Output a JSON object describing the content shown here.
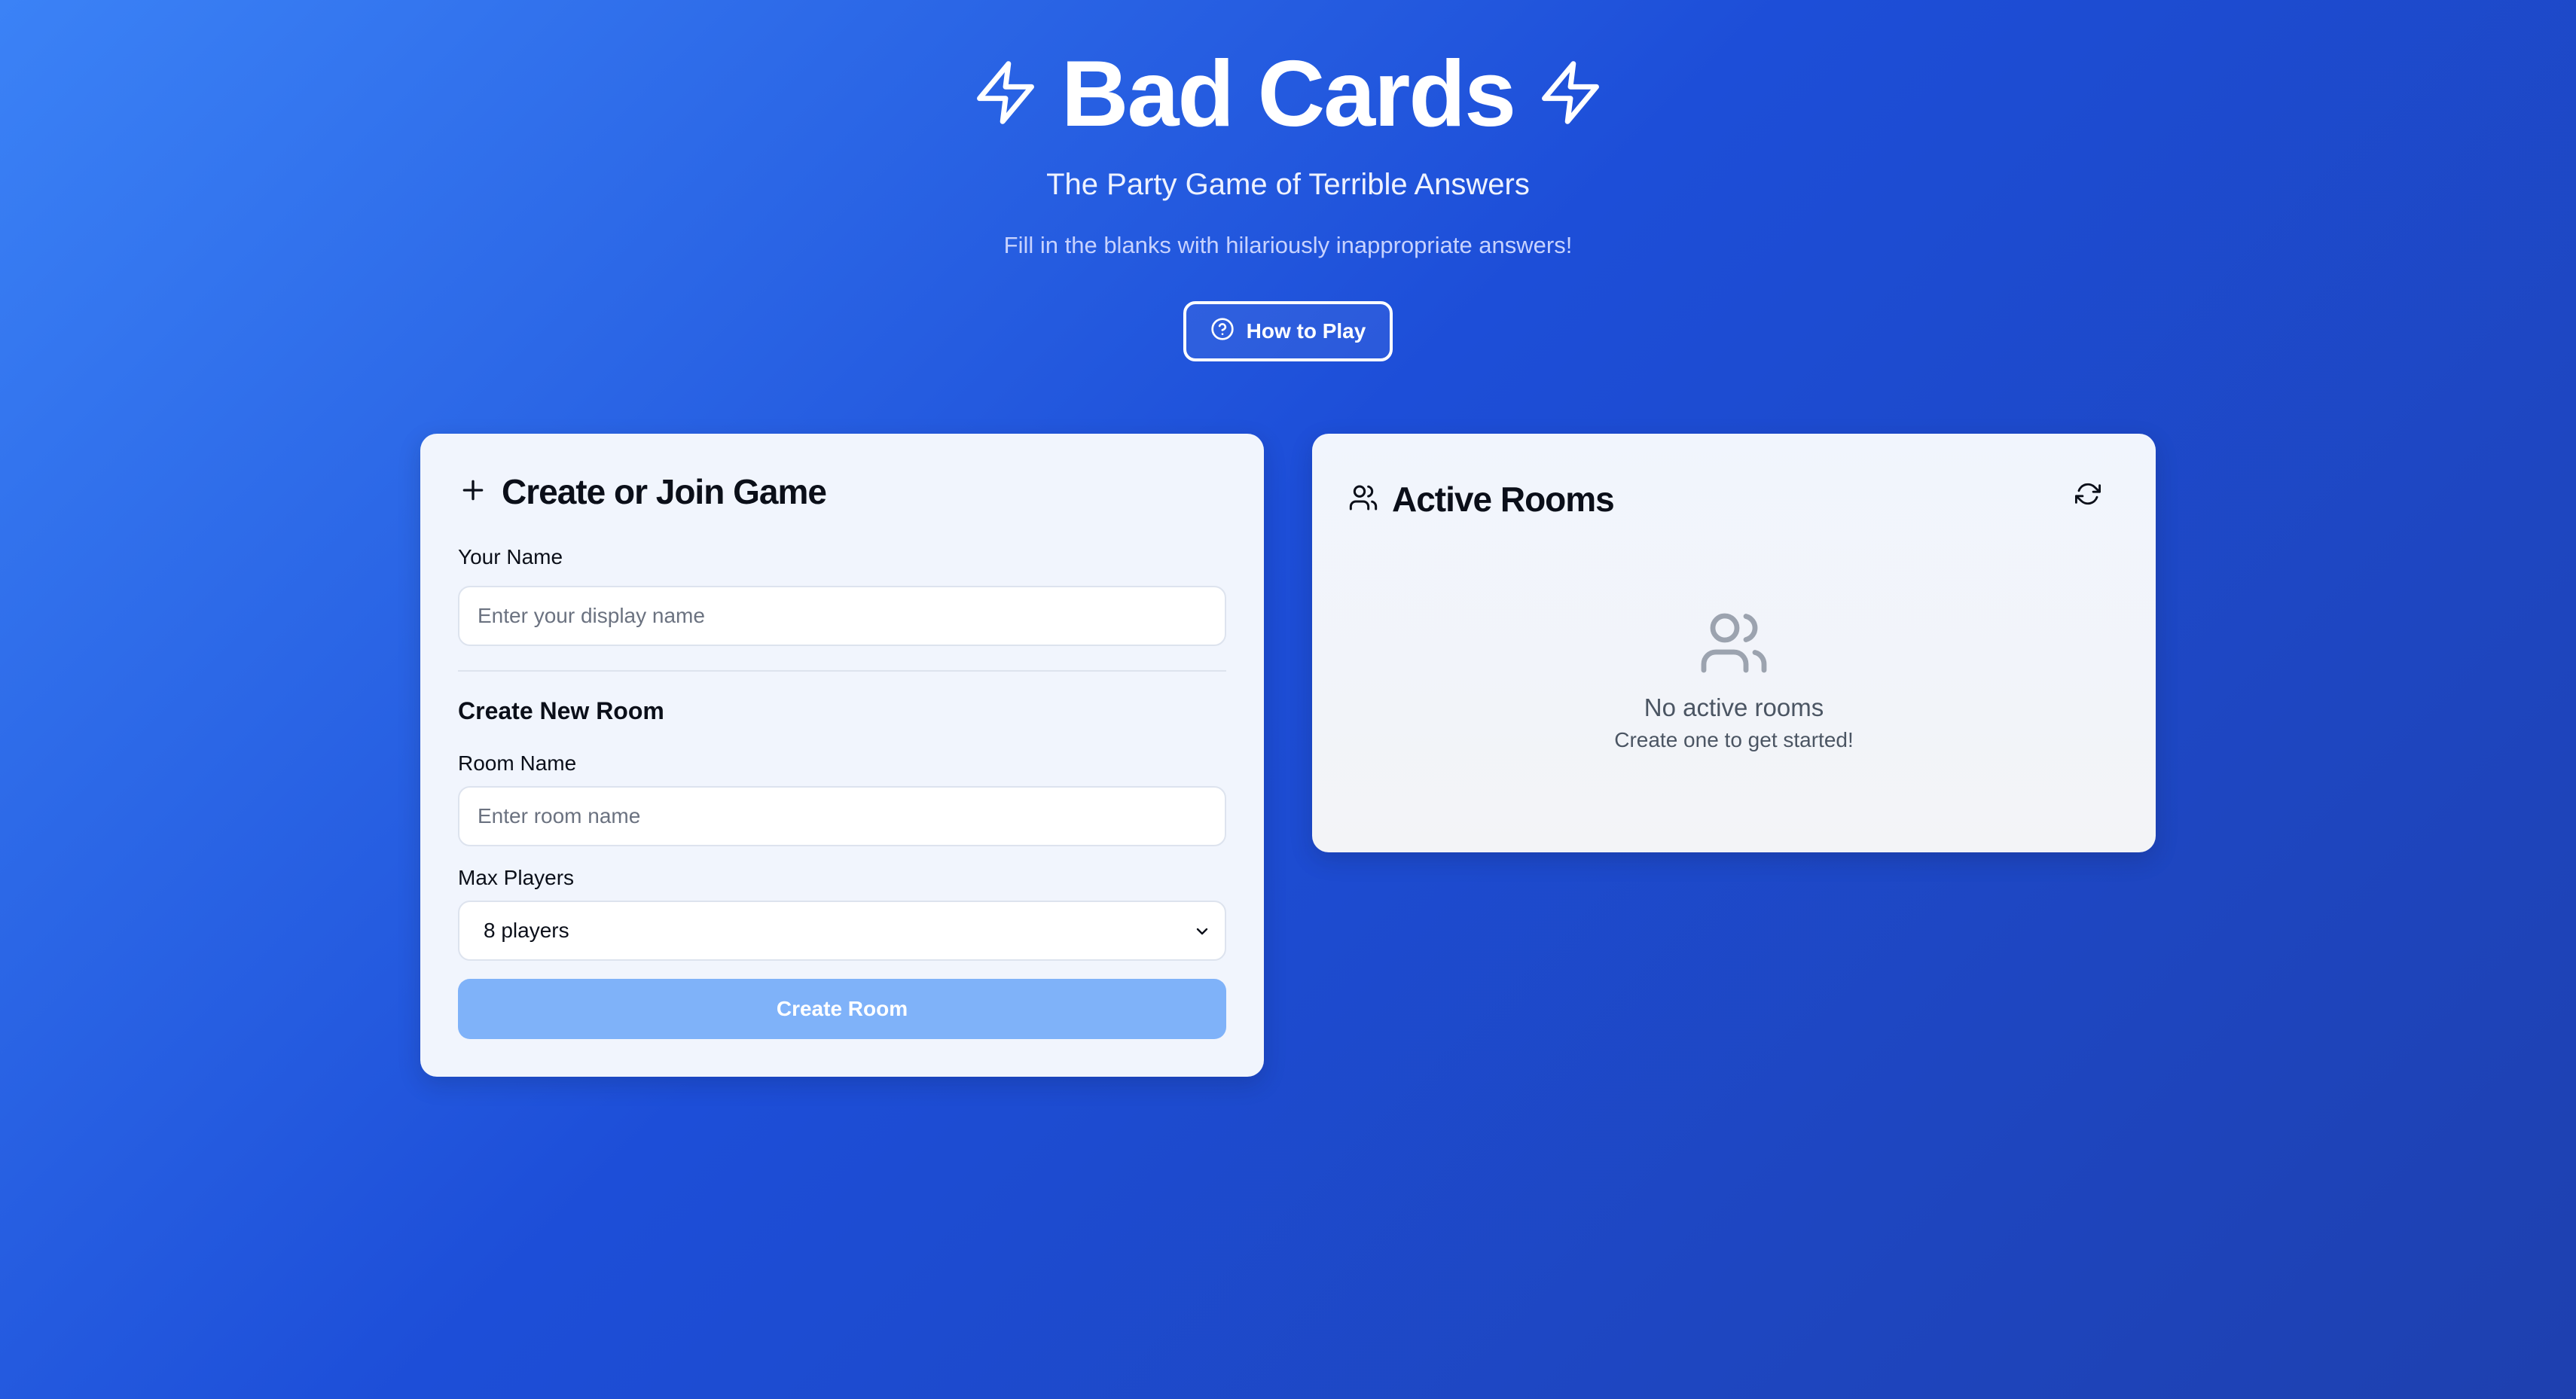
{
  "hero": {
    "title": "Bad Cards",
    "subtitle": "The Party Game of Terrible Answers",
    "tagline": "Fill in the blanks with hilariously inappropriate answers!",
    "how_to_play_label": "How to Play",
    "title_icon": "zap-icon",
    "help_icon": "question-circle-icon"
  },
  "create_card": {
    "icon": "plus-icon",
    "title": "Create or Join Game",
    "name_label": "Your Name",
    "name_placeholder": "Enter your display name",
    "name_value": "",
    "section_title": "Create New Room",
    "room_label": "Room Name",
    "room_placeholder": "Enter room name",
    "room_value": "",
    "max_players_label": "Max Players",
    "max_players_value": "8 players",
    "create_button_label": "Create Room"
  },
  "rooms_card": {
    "icon": "users-icon",
    "title": "Active Rooms",
    "refresh_icon": "refresh-icon",
    "empty_icon": "users-icon",
    "empty_title": "No active rooms",
    "empty_subtitle": "Create one to get started!"
  },
  "colors": {
    "background_start": "#3b82f6",
    "background_end": "#1e40af",
    "card_background": "#f1f5fd",
    "button_disabled": "#7fb2f9"
  }
}
